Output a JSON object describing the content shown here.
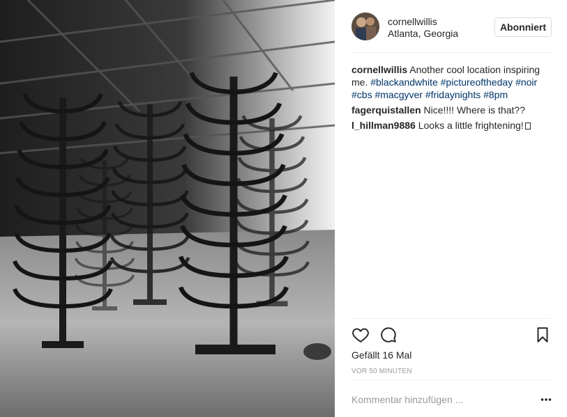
{
  "post": {
    "author": "cornellwillis",
    "location": "Atlanta, Georgia",
    "follow_label": "Abonniert",
    "photo_alt": "Black and white photo of industrial rack structures in a warehouse"
  },
  "comments": [
    {
      "user": "cornellwillis",
      "text": "Another cool location inspiring me.",
      "hashtags": [
        "#blackandwhite",
        "#pictureoftheday",
        "#noir",
        "#cbs",
        "#macgyver",
        "#fridaynights",
        "#8pm"
      ]
    },
    {
      "user": "fagerquistallen",
      "text": "Nice!!!! Where is that??"
    },
    {
      "user": "l_hillman9886",
      "text": "Looks a little frightening!"
    }
  ],
  "actions": {
    "like_icon": "heart-icon",
    "comment_icon": "comment-bubble-icon",
    "save_icon": "bookmark-icon",
    "likes_text": "Gefällt 16 Mal",
    "timestamp": "VOR 50 MINUTEN"
  },
  "comment_box": {
    "placeholder": "Kommentar hinzufügen ...",
    "more_icon": "more-options-icon"
  },
  "colors": {
    "hashtag": "#003569",
    "text": "#262626",
    "muted": "#999999",
    "divider": "#efefef"
  }
}
